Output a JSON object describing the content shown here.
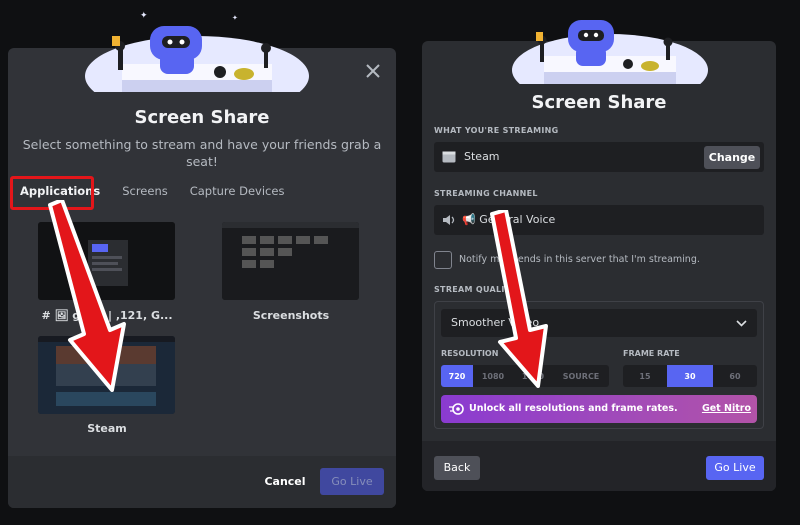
{
  "left": {
    "title": "Screen Share",
    "subtitle_line1": "Select something to stream and have your friends grab a",
    "subtitle_line2": "seat!",
    "tabs": [
      {
        "label": "Applications",
        "active": true
      },
      {
        "label": "Screens",
        "active": false
      },
      {
        "label": "Capture Devices",
        "active": false
      }
    ],
    "thumbnails": [
      {
        "label": "# 🖼 ge          at | ,121, G..."
      },
      {
        "label": "Screenshots"
      },
      {
        "label": "Steam"
      }
    ],
    "cancel_label": "Cancel",
    "golive_label": "Go Live"
  },
  "right": {
    "title": "Screen Share",
    "streaming_label": "WHAT YOU'RE STREAMING",
    "streaming_value": "Steam",
    "change_label": "Change",
    "channel_label": "STREAMING CHANNEL",
    "channel_value": "📢 General Voice",
    "notify_label": "Notify my friends in this server that I'm streaming.",
    "quality_label": "STREAM QUALITY",
    "quality_value": "Smoother Video",
    "resolution_label": "RESOLUTION",
    "resolutions": [
      {
        "label": "720",
        "selected": true
      },
      {
        "label": "1080",
        "selected": false
      },
      {
        "label": "1440",
        "selected": false
      },
      {
        "label": "SOURCE",
        "selected": false
      }
    ],
    "framerate_label": "FRAME RATE",
    "framerates": [
      {
        "label": "15",
        "selected": false
      },
      {
        "label": "30",
        "selected": true
      },
      {
        "label": "60",
        "selected": false
      }
    ],
    "nitro_text": "Unlock all resolutions and frame rates.",
    "nitro_cta": "Get Nitro",
    "back_label": "Back",
    "golive_label": "Go Live"
  },
  "colors": {
    "accent": "#5865f2",
    "annotation_red": "#e3161a",
    "panel_bg": "#313338"
  }
}
